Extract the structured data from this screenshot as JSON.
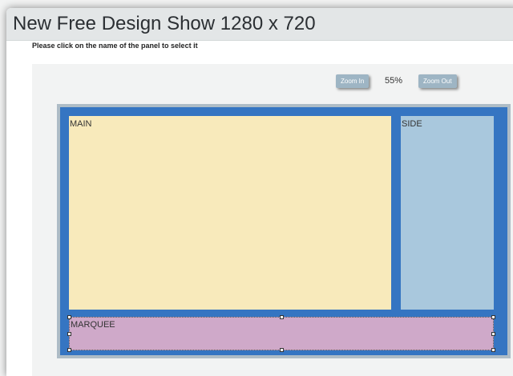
{
  "app": {
    "title": "New Free Design Show 1280 x 720"
  },
  "instruction": "Please click on the name of the panel to select it",
  "zoom": {
    "zoom_in_label": "Zoom In",
    "zoom_out_label": "Zoom Out",
    "level": "55%"
  },
  "panels": {
    "main": {
      "label": "MAIN",
      "color": "#f8eabb"
    },
    "side": {
      "label": "SIDE",
      "color": "#a9c8dd"
    },
    "marquee": {
      "label": "MARQUEE",
      "color": "#cfa9c9",
      "selected": true
    }
  },
  "colors": {
    "canvas_background": "#3575c2",
    "zoom_button": "#9eb5c4"
  }
}
